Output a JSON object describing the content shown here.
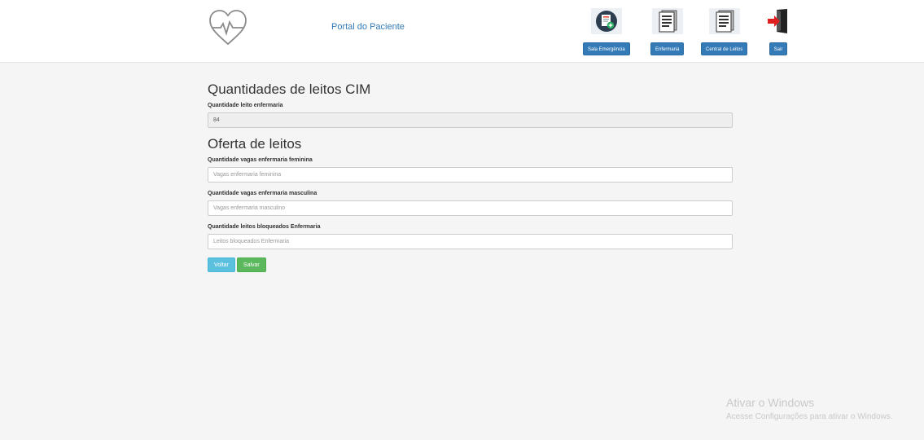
{
  "header": {
    "brand": "Portal do Paciente",
    "nav": [
      {
        "label": "Sala Emergência",
        "icon": "clipboard-plus-icon"
      },
      {
        "label": "Enfermaria",
        "icon": "document-icon"
      },
      {
        "label": "Central de Leitos",
        "icon": "document-icon"
      },
      {
        "label": "Sair",
        "icon": "exit-door-icon"
      }
    ]
  },
  "main": {
    "section1_title": "Quantidades de leitos CIM",
    "field_leito_label": "Quantidade leito enfermaria",
    "field_leito_value": "84",
    "section2_title": "Oferta de leitos",
    "fields": [
      {
        "label": "Quantidade vagas enfermaria feminina",
        "placeholder": "Vagas enfermaria feminina"
      },
      {
        "label": "Quantidade vagas enfermaria masculina",
        "placeholder": "Vagas enfermaria masculino"
      },
      {
        "label": "Quantidade leitos bloqueados Enfermaria",
        "placeholder": "Leitos bloqueados Enfermaria"
      }
    ],
    "buttons": {
      "back": "Voltar",
      "save": "Salvar"
    }
  },
  "watermark": {
    "line1": "Ativar o Windows",
    "line2": "Acesse Configurações para ativar o Windows."
  }
}
